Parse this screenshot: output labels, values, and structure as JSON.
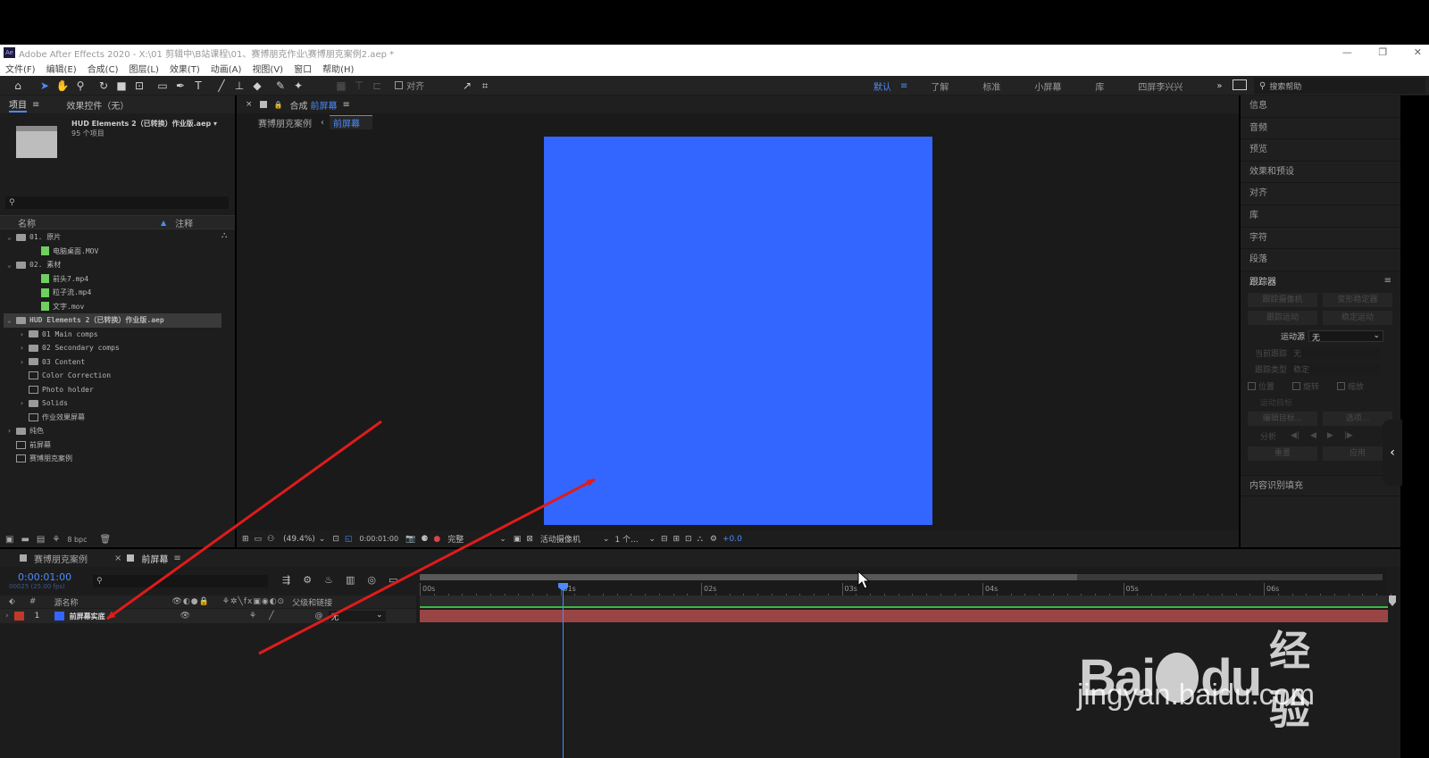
{
  "window": {
    "title": "Adobe After Effects 2020 - X:\\01 剪辑中\\B站课程\\01、赛博朋克作业\\赛博朋克案例2.aep *"
  },
  "menu": [
    "文件(F)",
    "编辑(E)",
    "合成(C)",
    "图层(L)",
    "效果(T)",
    "动画(A)",
    "视图(V)",
    "窗口",
    "帮助(H)"
  ],
  "toolbar": {
    "align_label": "对齐",
    "workspaces": [
      "默认",
      "了解",
      "标准",
      "小屏幕",
      "库",
      "四屏李兴兴"
    ],
    "active_workspace": "默认",
    "search_help_placeholder": "搜索帮助"
  },
  "project_panel": {
    "tab": "项目",
    "effects_tab": "效果控件（无）",
    "selected_name": "HUD Elements 2（已转换）作业版.aep ▾",
    "item_count": "95 个项目",
    "col_name": "名称",
    "col_comment": "注释",
    "tree": [
      {
        "kind": "folder",
        "indent": 0,
        "label": "01. 原片"
      },
      {
        "kind": "file",
        "indent": 2,
        "label": "电脑桌面.MOV"
      },
      {
        "kind": "folder",
        "indent": 0,
        "label": "02. 素材"
      },
      {
        "kind": "file",
        "indent": 2,
        "label": "前头7.mp4"
      },
      {
        "kind": "file",
        "indent": 2,
        "label": "粒子流.mp4"
      },
      {
        "kind": "file",
        "indent": 2,
        "label": "文字.mov"
      },
      {
        "kind": "folder",
        "indent": 0,
        "label": "HUD Elements 2（已转换）作业版.aep",
        "selected": true
      },
      {
        "kind": "folder",
        "indent": 1,
        "label": "01 Main comps"
      },
      {
        "kind": "folder",
        "indent": 1,
        "label": "02 Secondary comps"
      },
      {
        "kind": "folder",
        "indent": 1,
        "label": "03 Content"
      },
      {
        "kind": "comp",
        "indent": 1,
        "label": "Color Correction"
      },
      {
        "kind": "comp",
        "indent": 1,
        "label": "Photo holder"
      },
      {
        "kind": "folder",
        "indent": 1,
        "label": "Solids"
      },
      {
        "kind": "comp",
        "indent": 1,
        "label": "作业效果屏幕"
      },
      {
        "kind": "folder",
        "indent": 0,
        "label": "纯色"
      },
      {
        "kind": "comp",
        "indent": 0,
        "label": "前屏幕"
      },
      {
        "kind": "comp",
        "indent": 0,
        "label": "赛博朋克案例"
      }
    ],
    "bpc": "8 bpc"
  },
  "comp_panel": {
    "tab_prefix": "合成",
    "tab_name": "前屏幕",
    "breadcrumb_parent": "赛博朋克案例",
    "breadcrumb_current": "前屏幕",
    "solid_color": "#3366ff",
    "zoom": "(49.4%)",
    "timecode": "0:00:01:00",
    "resolution": "完整",
    "camera": "活动摄像机",
    "views": "1 个...",
    "exposure": "+0.0"
  },
  "right_panel": {
    "items": [
      "信息",
      "音频",
      "预览",
      "效果和预设",
      "对齐",
      "库",
      "字符",
      "段落"
    ],
    "tracker": {
      "title": "跟踪器",
      "btn_track_camera": "跟踪摄像机",
      "btn_warp_stabilizer": "变形稳定器",
      "btn_track_motion": "跟踪运动",
      "btn_stabilize_motion": "稳定运动",
      "motion_source_label": "运动源",
      "motion_source_value": "无",
      "current_track_label": "当前跟踪",
      "current_track_value": "无",
      "track_type_label": "跟踪类型",
      "track_type_value": "稳定",
      "position": "位置",
      "rotation": "旋转",
      "scale": "缩放",
      "motion_target": "运动目标",
      "edit_target": "编辑目标...",
      "options": "选项...",
      "analyze": "分析",
      "reset": "重置",
      "apply": "应用"
    },
    "content_aware_fill": "内容识别填充"
  },
  "timeline": {
    "tabs": [
      "赛博朋克案例",
      "前屏幕"
    ],
    "active_tab": "前屏幕",
    "timecode": "0:00:01:00",
    "fps_info": "00025 (25.00 fps)",
    "col_source_name": "源名称",
    "col_parent": "父级和链接",
    "ruler": [
      "00s",
      "01s",
      "02s",
      "03s",
      "04s",
      "05s",
      "06s"
    ],
    "layers": [
      {
        "index": "1",
        "name": "前屏幕实底",
        "label_color": "#c0392b",
        "parent": "无",
        "bar_color": "#9a4545"
      }
    ]
  },
  "watermark": {
    "brand": "Bai",
    "brand2": "du",
    "suffix": "经验",
    "url": "jingyan.baidu.com"
  }
}
